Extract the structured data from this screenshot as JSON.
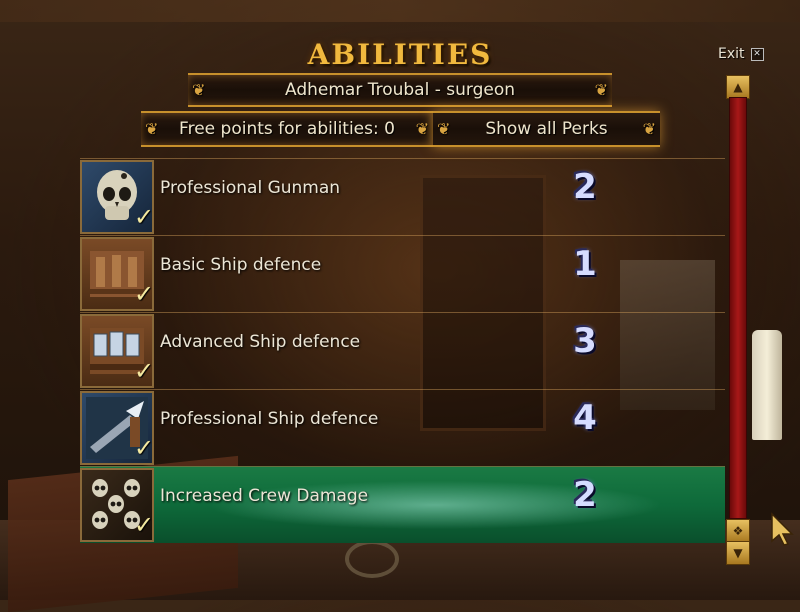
{
  "title": "ABILITIES",
  "exit_label": "Exit",
  "exit_close_glyph": "✕",
  "character": "Adhemar Troubal - surgeon",
  "free_points": "Free points for abilities: 0",
  "show_perks": "Show all Perks",
  "abilities": [
    {
      "label": "Professional Gunman",
      "value": "2",
      "icon": "skull-icon",
      "checked": true,
      "selected": false
    },
    {
      "label": "Basic Ship defence",
      "value": "1",
      "icon": "ship-hull-icon",
      "checked": true,
      "selected": false
    },
    {
      "label": "Advanced Ship defence",
      "value": "3",
      "icon": "ship-armor-icon",
      "checked": true,
      "selected": false
    },
    {
      "label": "Professional Ship defence",
      "value": "4",
      "icon": "cannon-icon",
      "checked": true,
      "selected": false
    },
    {
      "label": "Increased Crew Damage",
      "value": "2",
      "icon": "skulls-icon",
      "checked": true,
      "selected": true
    }
  ],
  "check_glyph": "✓",
  "colors": {
    "title": "#f1b93e",
    "selected_row": "#0e6a3a",
    "scroll_track": "#a81818"
  }
}
